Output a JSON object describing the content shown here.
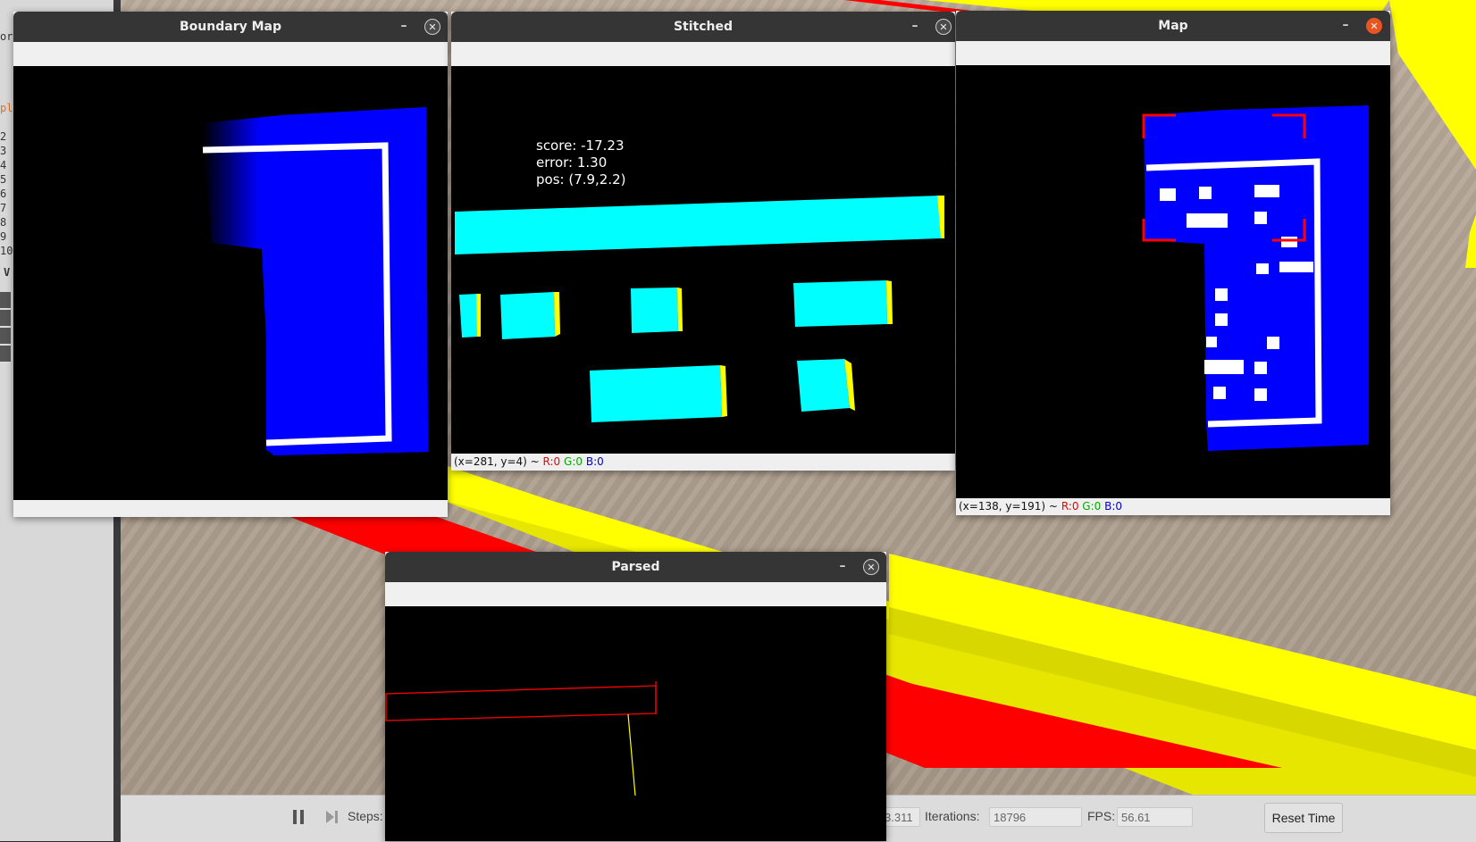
{
  "left_panel": {
    "fragments": [
      "orc",
      "pla",
      "2",
      "3",
      "4",
      "5",
      "6",
      "7",
      "8",
      "9",
      "10",
      "V"
    ]
  },
  "windows": {
    "boundary_map": {
      "title": "Boundary Map",
      "minimize": "–",
      "close": "✕"
    },
    "stitched": {
      "title": "Stitched",
      "minimize": "–",
      "close": "✕",
      "overlay": {
        "score": "score: -17.23",
        "error": "error: 1.30",
        "pos": "pos: (7.9,2.2)"
      },
      "status": {
        "coords": "(x=281, y=4) ~",
        "r": "R:0",
        "g": "G:0",
        "b": "B:0"
      }
    },
    "map": {
      "title": "Map",
      "minimize": "–",
      "close": "✕",
      "status": {
        "coords": "(x=138, y=191) ~",
        "r": "R:0",
        "g": "G:0",
        "b": "B:0"
      }
    },
    "parsed": {
      "title": "Parsed",
      "minimize": "–",
      "close": "✕"
    }
  },
  "toolbar": {
    "steps_label": "Steps:",
    "time_value": "3.311",
    "iterations_label": "Iterations:",
    "iterations_value": "18796",
    "fps_label": "FPS:",
    "fps_value": "56.61",
    "reset_label": "Reset Time",
    "pause_icon": "pause-icon",
    "step_icon": "step-forward-icon"
  },
  "colors": {
    "wall_yellow": "#ffff00",
    "wall_red": "#ff0000",
    "map_blue": "#0000ff",
    "obstacle_cyan": "#00ffff",
    "accent_close": "#e95420"
  }
}
